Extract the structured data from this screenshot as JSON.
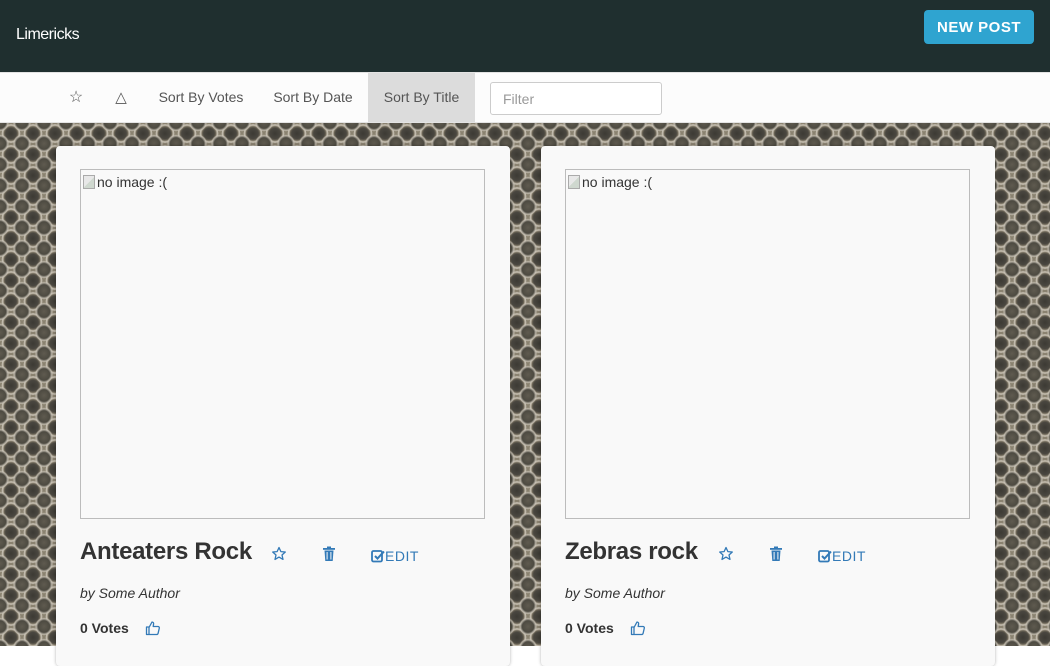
{
  "navbar": {
    "brand": "Limericks",
    "new_post_label": "NEW POST"
  },
  "sortbar": {
    "items": [
      {
        "label": "☆",
        "icon": "star-outline-icon"
      },
      {
        "label": "△",
        "icon": "triangle-outline-icon"
      },
      {
        "label": "Sort By Votes"
      },
      {
        "label": "Sort By Date"
      },
      {
        "label": "Sort By Title",
        "active": true
      }
    ],
    "filter_placeholder": "Filter"
  },
  "cards": [
    {
      "image_alt": "no image :(",
      "title": "Anteaters Rock",
      "edit_label": "EDIT",
      "author": "by Some Author",
      "votes": "0 Votes"
    },
    {
      "image_alt": "no image :(",
      "title": "Zebras rock",
      "edit_label": "EDIT",
      "author": "by Some Author",
      "votes": "0 Votes"
    }
  ],
  "colors": {
    "navbar_bg": "#1f2f2f",
    "accent": "#2fa4d0",
    "link": "#337ab7"
  }
}
